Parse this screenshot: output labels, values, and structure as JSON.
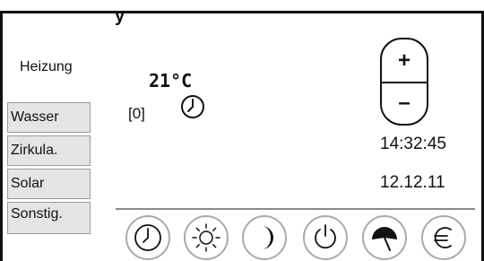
{
  "header": {
    "title": "y"
  },
  "sidebar": {
    "heading": "Heizung",
    "items": [
      {
        "label": "Wasser"
      },
      {
        "label": "Zirkula."
      },
      {
        "label": "Solar"
      },
      {
        "label": "Sonstig."
      }
    ]
  },
  "main": {
    "temperature": {
      "value": "21",
      "unit": "°C"
    },
    "program": "[0]",
    "timer_icon": "clock-icon"
  },
  "stepper": {
    "plus": "+",
    "minus": "–"
  },
  "clock": {
    "time": "14:32:45",
    "date": "12.12.11"
  },
  "bottom_buttons": [
    {
      "icon": "clock-icon"
    },
    {
      "icon": "sun-icon"
    },
    {
      "icon": "moon-icon"
    },
    {
      "icon": "power-icon"
    },
    {
      "icon": "party-icon"
    },
    {
      "icon": "euro-icon"
    }
  ]
}
